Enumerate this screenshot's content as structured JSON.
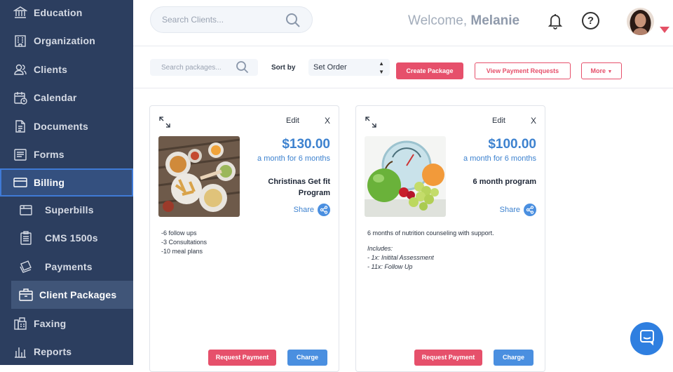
{
  "sidebar": {
    "items": [
      {
        "label": "Education",
        "icon": "building-icon"
      },
      {
        "label": "Organization",
        "icon": "org-icon"
      },
      {
        "label": "Clients",
        "icon": "users-icon"
      },
      {
        "label": "Calendar",
        "icon": "calendar-icon"
      },
      {
        "label": "Documents",
        "icon": "document-icon"
      },
      {
        "label": "Forms",
        "icon": "forms-icon"
      },
      {
        "label": "Billing",
        "icon": "billing-icon",
        "state": "active"
      },
      {
        "label": "Superbills",
        "icon": "superbill-icon"
      },
      {
        "label": "CMS 1500s",
        "icon": "clipboard-icon"
      },
      {
        "label": "Payments",
        "icon": "payments-icon"
      },
      {
        "label": "Client Packages",
        "icon": "package-icon",
        "state": "selected"
      },
      {
        "label": "Faxing",
        "icon": "fax-icon"
      },
      {
        "label": "Reports",
        "icon": "reports-icon"
      }
    ]
  },
  "header": {
    "search_placeholder": "Search Clients...",
    "welcome_prefix": "Welcome,",
    "user_name": "Melanie"
  },
  "toolbar": {
    "search_placeholder": "Search packages...",
    "sort_label": "Sort by",
    "sort_value": "Set Order",
    "create_label": "Create Package",
    "view_requests_label": "View Payment Requests",
    "more_label": "More"
  },
  "cards": [
    {
      "edit": "Edit",
      "close": "X",
      "price": "$130.00",
      "period": "a month for 6 months",
      "name": "Christinas Get fit Program",
      "share": "Share",
      "lines": [
        "-6 follow ups",
        "-3 Consultations",
        "-10 meal plans"
      ],
      "request_label": "Request Payment",
      "charge_label": "Charge"
    },
    {
      "edit": "Edit",
      "close": "X",
      "price": "$100.00",
      "period": "a month for 6 months",
      "name": "6 month program",
      "share": "Share",
      "description": "6 months of nutrition counseling with support.",
      "includes_title": "Includes:",
      "includes": [
        "- 1x: Initital Assessment",
        "- 11x: Follow Up"
      ],
      "request_label": "Request Payment",
      "charge_label": "Charge"
    }
  ],
  "colors": {
    "sidebar_bg": "#2c3e5f",
    "accent_red": "#e6506b",
    "accent_blue": "#3d82cf"
  }
}
